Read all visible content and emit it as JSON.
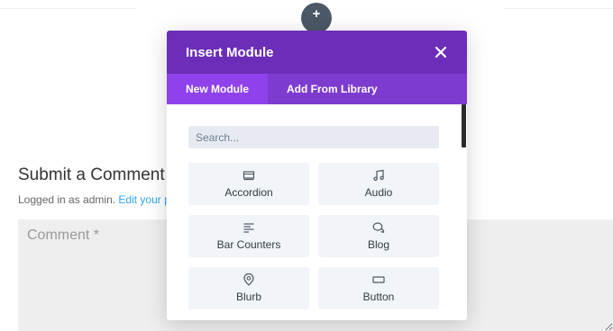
{
  "page": {
    "comment_heading": "Submit a Comment",
    "logged_in_prefix": "Logged in as admin. ",
    "edit_link": "Edit your p",
    "comment_placeholder": "Comment *"
  },
  "add_button": {
    "label": "+",
    "icon": "plus-icon"
  },
  "modal": {
    "title": "Insert Module",
    "close_icon": "close-icon",
    "colors": {
      "header": "#6c2eb9",
      "tabs_bar": "#7d3bcf",
      "active_tab": "#8f42ec",
      "module_tile": "#f1f4f8",
      "search_bg": "#e7ebf1"
    },
    "tabs": [
      {
        "label": "New Module",
        "active": true
      },
      {
        "label": "Add From Library",
        "active": false
      }
    ],
    "search": {
      "placeholder": "Search...",
      "value": ""
    },
    "modules": [
      {
        "label": "Accordion",
        "icon": "accordion-icon"
      },
      {
        "label": "Audio",
        "icon": "music-note-icon"
      },
      {
        "label": "Bar Counters",
        "icon": "bar-counters-icon"
      },
      {
        "label": "Blog",
        "icon": "blog-bubbles-icon"
      },
      {
        "label": "Blurb",
        "icon": "blurb-pin-icon"
      },
      {
        "label": "Button",
        "icon": "button-rect-icon"
      }
    ]
  }
}
